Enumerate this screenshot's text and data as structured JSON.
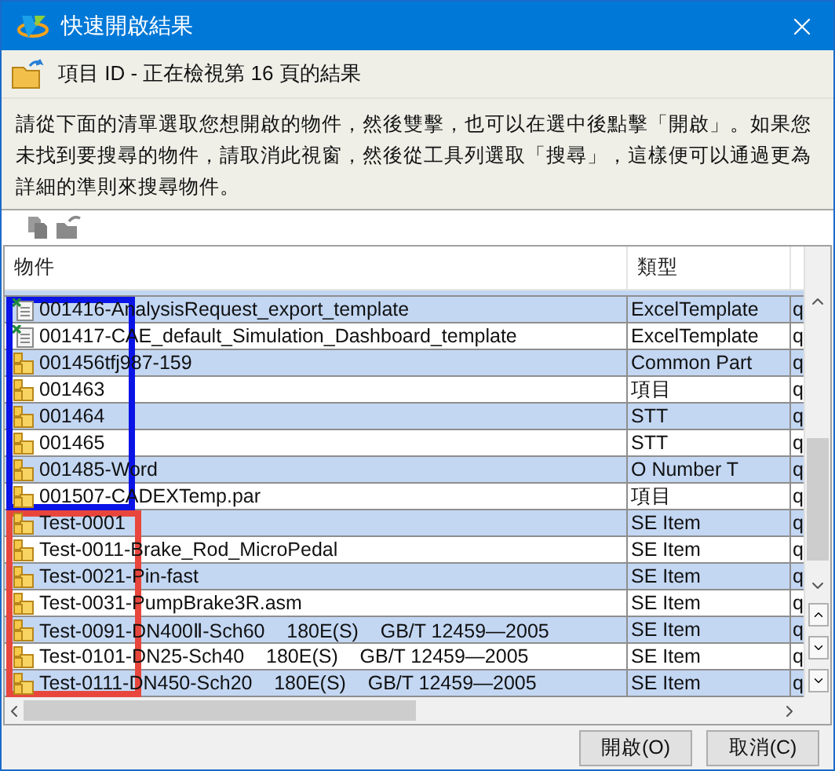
{
  "window": {
    "title": "快速開啟結果"
  },
  "header": {
    "title": "項目 ID - 正在檢視第 16 頁的結果"
  },
  "instructions": "請從下面的清單選取您想開啟的物件，然後雙擊，也可以在選中後點擊「開啟」。如果您未找到要搜尋的物件，請取消此視窗，然後從工具列選取「搜尋」，這樣便可以通過更為詳細的準則來搜尋物件。",
  "table": {
    "columns": [
      "物件",
      "類型"
    ],
    "row_groups": [
      {
        "color": "#0a14e6",
        "rows": [
          {
            "kind": "excel",
            "name": "001416-AnalysisRequest_export_template",
            "type": "ExcelTemplate",
            "column_3": "q"
          },
          {
            "kind": "excel",
            "name": "001417-CAE_default_Simulation_Dashboard_template",
            "type": "ExcelTemplate",
            "column_3": "q"
          },
          {
            "kind": "item",
            "name": "001456tfj987-159",
            "type": "Common Part",
            "column_3": "q"
          },
          {
            "kind": "item",
            "name": "001463",
            "type": "項目",
            "column_3": "q"
          },
          {
            "kind": "item",
            "name": "001464",
            "type": "STT",
            "column_3": "q"
          },
          {
            "kind": "item",
            "name": "001465",
            "type": "STT",
            "column_3": "q"
          },
          {
            "kind": "item",
            "name": "001485-Word",
            "type": "O Number T",
            "column_3": "q"
          },
          {
            "kind": "item",
            "name": "001507-CADEXTemp.par",
            "type": "項目",
            "column_3": "q"
          }
        ]
      },
      {
        "color": "#e8463c",
        "rows": [
          {
            "kind": "item",
            "name": "Test-0001",
            "type": "SE Item",
            "column_3": "q"
          },
          {
            "kind": "item",
            "name": "Test-0011-Brake_Rod_MicroPedal",
            "type": "SE Item",
            "column_3": "q"
          },
          {
            "kind": "item",
            "name": "Test-0021-Pin-fast",
            "type": "SE Item",
            "column_3": "q"
          },
          {
            "kind": "item",
            "name": "Test-0031-PumpBrake3R.asm",
            "type": "SE Item",
            "column_3": "q"
          },
          {
            "kind": "item",
            "name": "Test-0091-DN400Ⅱ-Sch60    180E(S)    GB/T 12459—2005",
            "type": "SE Item",
            "column_3": "q"
          },
          {
            "kind": "item",
            "name": "Test-0101-DN25-Sch40    180E(S)    GB/T 12459—2005",
            "type": "SE Item",
            "column_3": "q"
          },
          {
            "kind": "item",
            "name": "Test-0111-DN450-Sch20    180E(S)    GB/T 12459—2005",
            "type": "SE Item",
            "column_3": "q"
          }
        ]
      }
    ]
  },
  "buttons": [
    "開啟(O)",
    "取消(C)"
  ]
}
